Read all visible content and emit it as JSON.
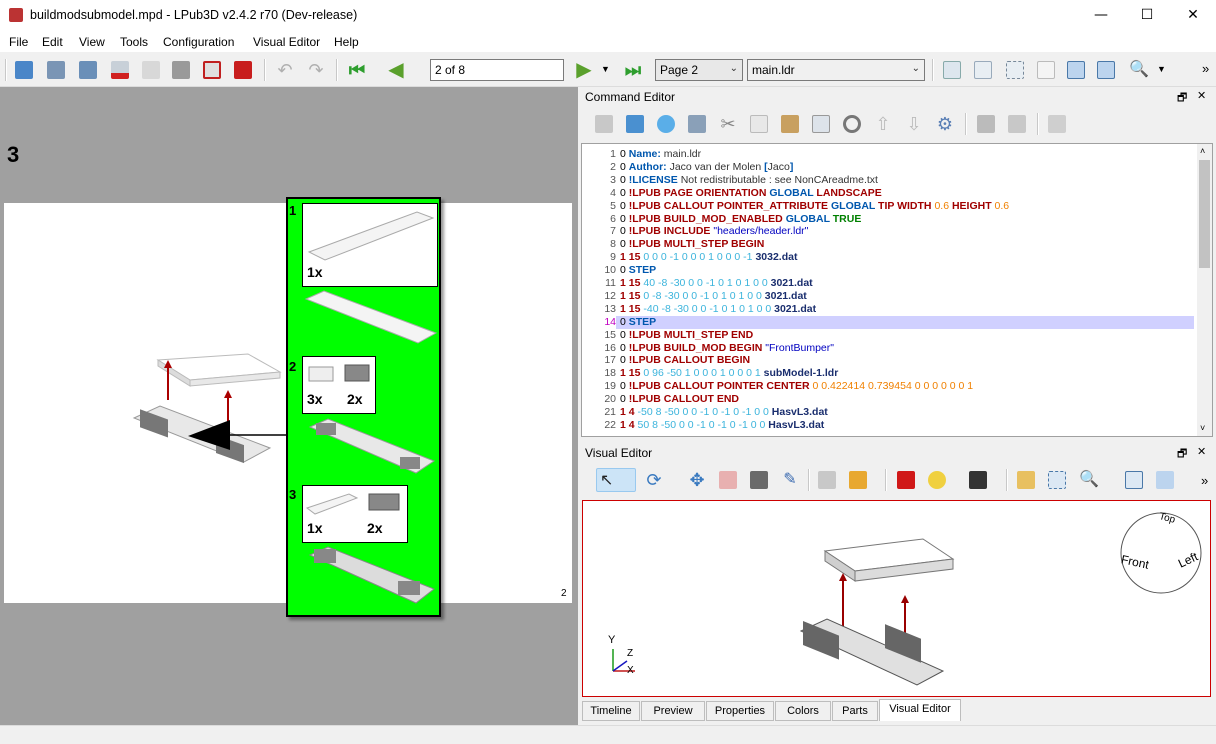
{
  "window": {
    "title": "buildmodsubmodel.mpd - LPub3D v2.4.2 r70 (Dev-release)",
    "minimize": "—",
    "maximize": "☐",
    "close": "✕"
  },
  "menu": [
    "File",
    "Edit",
    "View",
    "Tools",
    "Configuration",
    "Visual Editor",
    "Help"
  ],
  "toolbar": {
    "page_field": "2 of 8",
    "page_combo": "Page 2",
    "model_combo": "main.ldr",
    "overflow": "»"
  },
  "page": {
    "step_number": "3",
    "page_number": "2",
    "callout": {
      "steps": [
        {
          "number": "1",
          "parts": [
            {
              "qty": "1x"
            }
          ]
        },
        {
          "number": "2",
          "parts": [
            {
              "qty": "3x"
            },
            {
              "qty": "2x"
            }
          ]
        },
        {
          "number": "3",
          "parts": [
            {
              "qty": "1x"
            },
            {
              "qty": "2x"
            }
          ]
        }
      ]
    }
  },
  "command_editor": {
    "title": "Command Editor",
    "float_icon": "🗗",
    "close_icon": "✕",
    "lines": [
      {
        "n": "1",
        "segs": [
          [
            "",
            "0 "
          ],
          [
            "kw-blue",
            "Name:"
          ],
          [
            "gray",
            " main.ldr"
          ]
        ]
      },
      {
        "n": "2",
        "segs": [
          [
            "",
            "0 "
          ],
          [
            "kw-blue",
            "Author:"
          ],
          [
            "gray",
            " Jaco van der Molen "
          ],
          [
            "kw-blue",
            "["
          ],
          [
            "gray",
            "Jaco"
          ],
          [
            "kw-blue",
            "]"
          ]
        ]
      },
      {
        "n": "3",
        "segs": [
          [
            "",
            "0 "
          ],
          [
            "kw-blue",
            "!LICENSE"
          ],
          [
            "gray",
            " Not redistributable : see NonCAreadme.txt"
          ]
        ]
      },
      {
        "n": "4",
        "segs": [
          [
            "",
            "0 "
          ],
          [
            "kw-red",
            "!LPUB PAGE ORIENTATION "
          ],
          [
            "kw-blue",
            "GLOBAL "
          ],
          [
            "kw-red",
            "LANDSCAPE"
          ]
        ]
      },
      {
        "n": "5",
        "segs": [
          [
            "",
            "0 "
          ],
          [
            "kw-red",
            "!LPUB CALLOUT POINTER_ATTRIBUTE "
          ],
          [
            "kw-blue",
            "GLOBAL "
          ],
          [
            "kw-red",
            "TIP WIDTH "
          ],
          [
            "num-o",
            "0.6 "
          ],
          [
            "kw-red",
            "HEIGHT "
          ],
          [
            "num-o",
            "0.6"
          ]
        ]
      },
      {
        "n": "6",
        "segs": [
          [
            "",
            "0 "
          ],
          [
            "kw-red",
            "!LPUB BUILD_MOD_ENABLED "
          ],
          [
            "kw-blue",
            "GLOBAL "
          ],
          [
            "kw-green",
            "TRUE"
          ]
        ]
      },
      {
        "n": "7",
        "segs": [
          [
            "",
            "0 "
          ],
          [
            "kw-red",
            "!LPUB INCLUDE "
          ],
          [
            "str",
            "\"headers/header.ldr\""
          ]
        ]
      },
      {
        "n": "8",
        "segs": [
          [
            "",
            "0 "
          ],
          [
            "kw-red",
            "!LPUB MULTI_STEP BEGIN"
          ]
        ]
      },
      {
        "n": "9",
        "segs": [
          [
            "num-r",
            "1 15 "
          ],
          [
            "num-c",
            "0 0 0 -1 0 0 0 1 0 0 0 -1 "
          ],
          [
            "nv",
            "3032.dat"
          ]
        ]
      },
      {
        "n": "10",
        "segs": [
          [
            "",
            "0 "
          ],
          [
            "kw-blue",
            "STEP"
          ]
        ]
      },
      {
        "n": "11",
        "segs": [
          [
            "num-r",
            "1 15 "
          ],
          [
            "num-c",
            "40 -8 -30 0 0 -1 0 1 0 1 0 0 "
          ],
          [
            "nv",
            "3021.dat"
          ]
        ]
      },
      {
        "n": "12",
        "segs": [
          [
            "num-r",
            "1 15 "
          ],
          [
            "num-c",
            "0 -8 -30 0 0 -1 0 1 0 1 0 0 "
          ],
          [
            "nv",
            "3021.dat"
          ]
        ]
      },
      {
        "n": "13",
        "segs": [
          [
            "num-r",
            "1 15 "
          ],
          [
            "num-c",
            "-40 -8 -30 0 0 -1 0 1 0 1 0 0 "
          ],
          [
            "nv",
            "3021.dat"
          ]
        ]
      },
      {
        "n": "14",
        "segs": [
          [
            "",
            "0 "
          ],
          [
            "kw-blue",
            "STEP"
          ]
        ],
        "highlight": true
      },
      {
        "n": "15",
        "segs": [
          [
            "",
            "0 "
          ],
          [
            "kw-red",
            "!LPUB MULTI_STEP END"
          ]
        ]
      },
      {
        "n": "16",
        "segs": [
          [
            "",
            "0 "
          ],
          [
            "kw-red",
            "!LPUB BUILD_MOD BEGIN "
          ],
          [
            "str",
            "\"FrontBumper\""
          ]
        ]
      },
      {
        "n": "17",
        "segs": [
          [
            "",
            "0 "
          ],
          [
            "kw-red",
            "!LPUB CALLOUT BEGIN"
          ]
        ]
      },
      {
        "n": "18",
        "segs": [
          [
            "num-r",
            "1 15 "
          ],
          [
            "num-c",
            "0 96 -50 1 0 0 0 1 0 0 0 1 "
          ],
          [
            "nv",
            "subModel-1.ldr"
          ]
        ]
      },
      {
        "n": "19",
        "segs": [
          [
            "",
            "0 "
          ],
          [
            "kw-red",
            "!LPUB CALLOUT POINTER CENTER "
          ],
          [
            "num-o",
            "0 0.422414 0.739454 0 0 0 0 0 0 1"
          ]
        ]
      },
      {
        "n": "20",
        "segs": [
          [
            "",
            "0 "
          ],
          [
            "kw-red",
            "!LPUB CALLOUT END"
          ]
        ]
      },
      {
        "n": "21",
        "segs": [
          [
            "num-r",
            "1 4 "
          ],
          [
            "num-c",
            "-50 8 -50 0 0 -1 0 -1 0 -1 0 0 "
          ],
          [
            "nv",
            "HasvL3.dat"
          ]
        ]
      },
      {
        "n": "22",
        "segs": [
          [
            "num-r",
            "1 4 "
          ],
          [
            "num-c",
            "50 8 -50 0 0 -1 0 -1 0 -1 0 0 "
          ],
          [
            "nv",
            "HasvL3.dat"
          ]
        ]
      }
    ]
  },
  "visual_editor": {
    "title": "Visual Editor",
    "float_icon": "🗗",
    "close_icon": "✕",
    "overflow": "»",
    "view_sphere": {
      "top": "Top",
      "front": "Front",
      "left": "Left"
    },
    "axes": {
      "y": "Y",
      "z": "Z",
      "x": "X"
    }
  },
  "tabs": [
    "Timeline",
    "Preview",
    "Properties",
    "Colors",
    "Parts",
    "Visual Editor"
  ],
  "active_tab": "Visual Editor",
  "colors": {
    "callout_bg": "#00ff00",
    "highlight_line": "#d0d0ff",
    "viewport_border": "#cc0000"
  }
}
